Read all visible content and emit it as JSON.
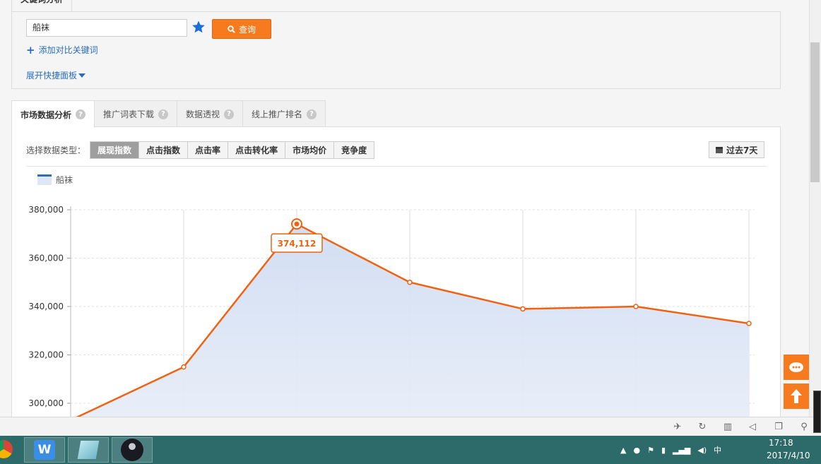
{
  "keyword_panel": {
    "tab_label": "关键词分析",
    "keyword_value": "船袜",
    "query_label": "查询",
    "add_compare_label": "添加对比关键词",
    "expand_label": "展开快捷面板"
  },
  "tabs": [
    {
      "label": "市场数据分析",
      "active": true
    },
    {
      "label": "推广词表下载",
      "active": false
    },
    {
      "label": "数据透视",
      "active": false
    },
    {
      "label": "线上推广排名",
      "active": false
    }
  ],
  "data_type": {
    "label": "选择数据类型：",
    "options": [
      {
        "label": "展现指数",
        "active": true
      },
      {
        "label": "点击指数",
        "active": false
      },
      {
        "label": "点击率",
        "active": false
      },
      {
        "label": "点击转化率",
        "active": false
      },
      {
        "label": "市场均价",
        "active": false
      },
      {
        "label": "竞争度",
        "active": false
      }
    ],
    "range_label": "过去7天"
  },
  "colors": {
    "accent": "#f77a1f",
    "line": "#f0620f",
    "area": "#dce6f5",
    "link": "#2a6ebc",
    "taskbar": "#2d6a6a"
  },
  "chart_data": {
    "type": "area",
    "series": [
      {
        "name": "船袜",
        "values": [
          293000,
          315000,
          374112,
          350000,
          339000,
          340000,
          333000
        ]
      }
    ],
    "x": [
      1,
      2,
      3,
      4,
      5,
      6,
      7
    ],
    "ylim": [
      290000,
      383000
    ],
    "yticks": [
      "380,000",
      "360,000",
      "340,000",
      "320,000",
      "300,000"
    ],
    "ytick_values": [
      380000,
      360000,
      340000,
      320000,
      300000
    ],
    "tooltip": {
      "index": 2,
      "label": "374,112"
    },
    "grid": true,
    "legend": "top-left"
  },
  "browser_bar": {
    "icons": [
      "pin-icon",
      "refresh-icon",
      "trash-icon",
      "speaker-icon",
      "window-icon",
      "search-icon"
    ]
  },
  "taskbar": {
    "clock_date": "2017/4/10",
    "clock_time": "17:18",
    "apps": [
      "chrome-icon",
      "wps-icon",
      "notes-icon",
      "avatar-app-icon"
    ]
  }
}
